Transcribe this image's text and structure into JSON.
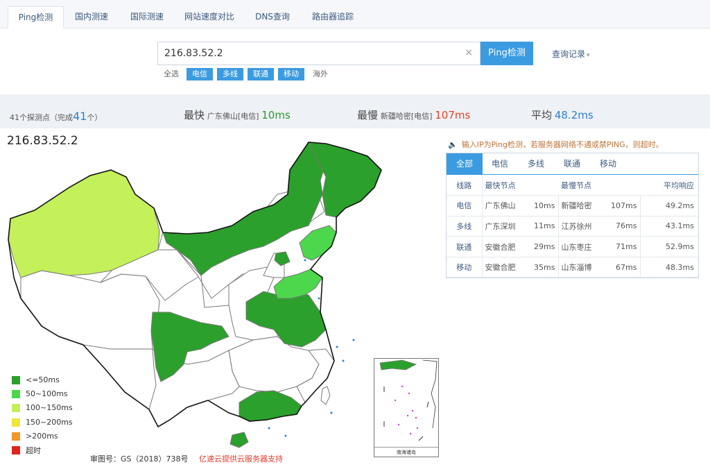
{
  "tabs": [
    {
      "label": "Ping检测",
      "active": true
    },
    {
      "label": "国内测速",
      "active": false
    },
    {
      "label": "国际测速",
      "active": false
    },
    {
      "label": "网站速度对比",
      "active": false
    },
    {
      "label": "DNS查询",
      "active": false
    },
    {
      "label": "路由器追踪",
      "active": false
    }
  ],
  "search": {
    "value": "216.83.52.2",
    "clear_icon": "×",
    "button_label": "Ping检测",
    "history_label": "查询记录",
    "history_caret": "▾"
  },
  "filters": [
    {
      "label": "全选",
      "selected": false
    },
    {
      "label": "电信",
      "selected": true
    },
    {
      "label": "多线",
      "selected": true
    },
    {
      "label": "联通",
      "selected": true
    },
    {
      "label": "移动",
      "selected": true
    },
    {
      "label": "海外",
      "selected": false
    }
  ],
  "stats": {
    "probe_prefix": "41个探测点（完成",
    "probe_done": "41",
    "probe_suffix": "个）",
    "fastest_label": "最快",
    "fastest_node": "广东佛山[电信]",
    "fastest_value": "10ms",
    "slowest_label": "最慢",
    "slowest_node": "新疆哈密[电信]",
    "slowest_value": "107ms",
    "average_label": "平均",
    "average_value": "48.2ms"
  },
  "map": {
    "ip": "216.83.52.2",
    "inset_caption": "南海诸岛",
    "legend": [
      {
        "label": "<=50ms",
        "color": "#2ca02c"
      },
      {
        "label": "50~100ms",
        "color": "#4cd74c"
      },
      {
        "label": "100~150ms",
        "color": "#c4f05a"
      },
      {
        "label": "150~200ms",
        "color": "#f0e63c"
      },
      {
        "label": ">200ms",
        "color": "#f0962a"
      },
      {
        "label": "超时",
        "color": "#e0241c"
      }
    ],
    "approval": "审图号：GS（2018）738号",
    "sponsor": "亿速云提供云服务器支持"
  },
  "notice": "输入IP为Ping检测，若服务器网络不通或禁PING，则超时。",
  "result_tabs": [
    "全部",
    "电信",
    "多线",
    "联通",
    "移动"
  ],
  "result_table": {
    "headers": [
      "线路",
      "最快节点",
      "最慢节点",
      "平均响应"
    ],
    "rows": [
      {
        "line": "电信",
        "fast_node": "广东佛山",
        "fast_ms": "10ms",
        "slow_node": "新疆哈密",
        "slow_ms": "107ms",
        "avg": "49.2ms"
      },
      {
        "line": "多线",
        "fast_node": "广东深圳",
        "fast_ms": "11ms",
        "slow_node": "江苏徐州",
        "slow_ms": "76ms",
        "avg": "43.1ms"
      },
      {
        "line": "联通",
        "fast_node": "安徽合肥",
        "fast_ms": "29ms",
        "slow_node": "山东枣庄",
        "slow_ms": "71ms",
        "avg": "52.9ms"
      },
      {
        "line": "移动",
        "fast_node": "安徽合肥",
        "fast_ms": "35ms",
        "slow_node": "山东淄博",
        "slow_ms": "67ms",
        "avg": "48.3ms"
      }
    ]
  }
}
